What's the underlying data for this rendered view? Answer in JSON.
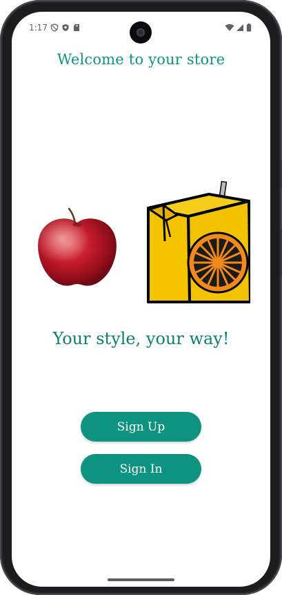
{
  "status_bar": {
    "time": "1:17",
    "icons": [
      "vpn-shield-icon",
      "security-shield-icon",
      "sd-card-icon",
      "wifi-icon",
      "cellular-signal-icon",
      "battery-icon"
    ]
  },
  "header": {
    "title": "Welcome to your store"
  },
  "images": [
    {
      "name": "apple-image",
      "description_icon": "apple"
    },
    {
      "name": "juice-box-image",
      "description_icon": "orange-juice-box"
    }
  ],
  "tagline": "Your style, your way!",
  "buttons": {
    "sign_up": "Sign Up",
    "sign_in": "Sign In"
  },
  "colors": {
    "accent": "#0f9381",
    "tagline": "#0d7e72",
    "button_text": "#ffffff"
  }
}
